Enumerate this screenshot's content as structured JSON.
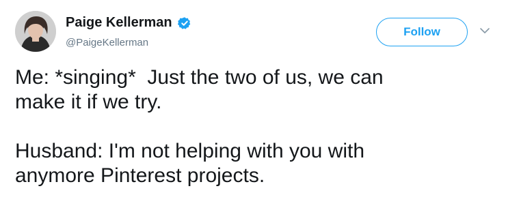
{
  "tweet": {
    "author": {
      "display_name": "Paige Kellerman",
      "handle": "@PaigeKellerman",
      "verified": true,
      "avatar_icon": "user-avatar"
    },
    "follow_label": "Follow",
    "menu_icon": "chevron-down-icon",
    "body": {
      "paragraph_1": "Me: *singing*  Just the two of us, we can\nmake it if we try.",
      "paragraph_2": "Husband: I'm not helping with you with\nanymore Pinterest projects."
    }
  },
  "colors": {
    "accent": "#1da1f2",
    "text": "#14171a",
    "secondary_text": "#657786",
    "chevron": "#8899a6"
  }
}
